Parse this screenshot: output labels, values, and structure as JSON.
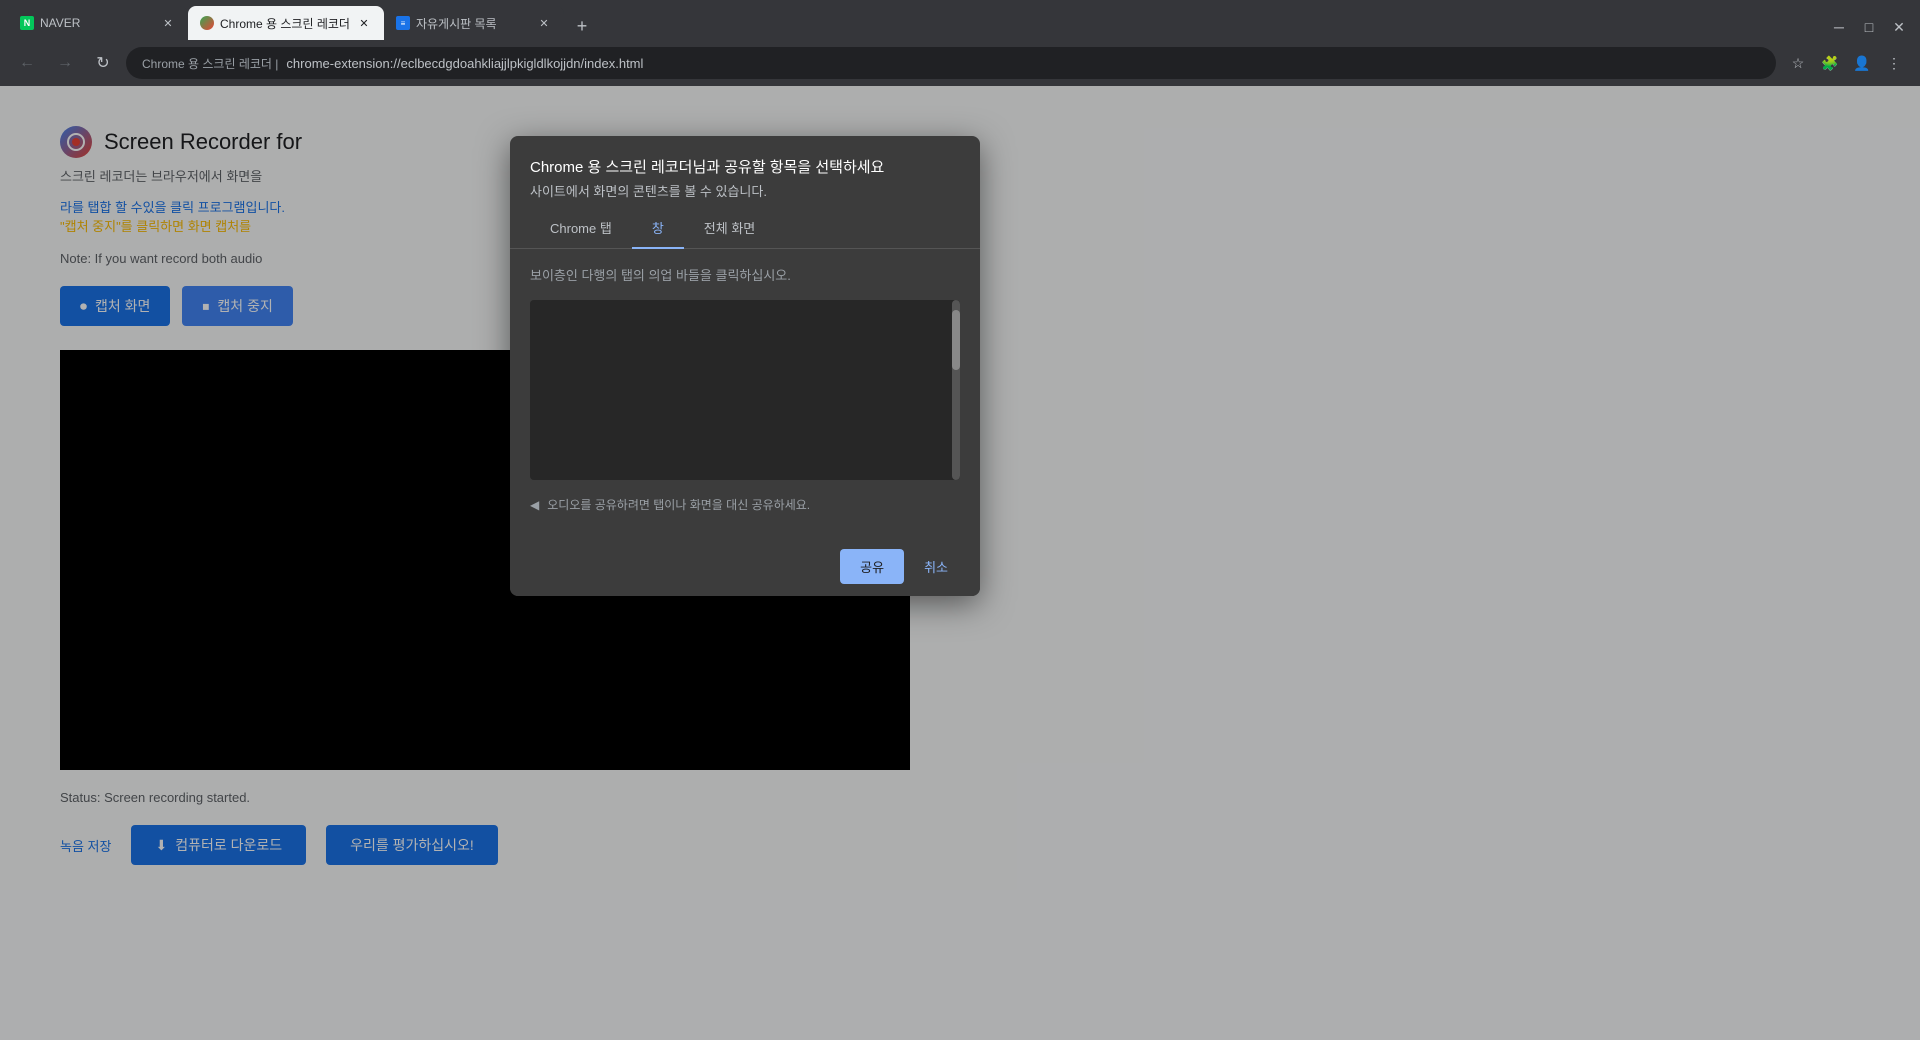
{
  "browser": {
    "tabs": [
      {
        "id": "tab-naver",
        "title": "NAVER",
        "active": false,
        "favicon": "naver"
      },
      {
        "id": "tab-recorder",
        "title": "Chrome 용 스크린 레코더",
        "active": true,
        "favicon": "recorder"
      },
      {
        "id": "tab-memo",
        "title": "자유게시판 목록",
        "active": false,
        "favicon": "memo"
      }
    ],
    "address": "chrome-extension://eclbecdgdoahkliajjlpkigldlkojjdn/index.html",
    "address_prefix": "Chrome 용 스크린 레코더  |"
  },
  "page": {
    "app_logo_text": "●",
    "main_title": "Screen Recorder for",
    "subtitle": "스크린 레코더는 브라우저에서 화면을",
    "link_text": "라를 탭합 할 수있을 클릭 프로그램입니다.",
    "capture_note": "\"캡처 중지\"를 클릭하면 화면 캡처를",
    "note_text": "Note: If you want record both audio",
    "btn_capture": "캡처 화면",
    "btn_stop": "캡처 중지",
    "status_text": "Status: Screen recording started.",
    "save_link": "녹음 저장",
    "btn_download": "컴퓨터로 다운로드",
    "btn_rate": "우리를 평가하십시오!"
  },
  "modal": {
    "title": "Chrome 용 스크린 레코더님과 공유할 항목을 선택하세요",
    "subtitle": "사이트에서 화면의 콘텐츠를 볼 수 있습니다.",
    "tabs": [
      {
        "id": "chrome-tab",
        "label": "Chrome 탭",
        "active": false
      },
      {
        "id": "window-tab",
        "label": "창",
        "active": true
      },
      {
        "id": "fullscreen-tab",
        "label": "전체 화면",
        "active": false
      }
    ],
    "hint_text": "보이층인 다행의 탭의 의업 바들을 클릭하십시오.",
    "audio_hint": "오디오를 공유하려면 탭이나 화면을 대신 공유하세요.",
    "btn_share": "공유",
    "btn_cancel": "취소"
  },
  "icons": {
    "back": "←",
    "forward": "→",
    "refresh": "↻",
    "home": "⌂",
    "star": "☆",
    "menu": "⋮",
    "record": "⏺",
    "stop": "⏹",
    "download": "⬇",
    "arrow_left": "◀",
    "new_tab": "+"
  }
}
